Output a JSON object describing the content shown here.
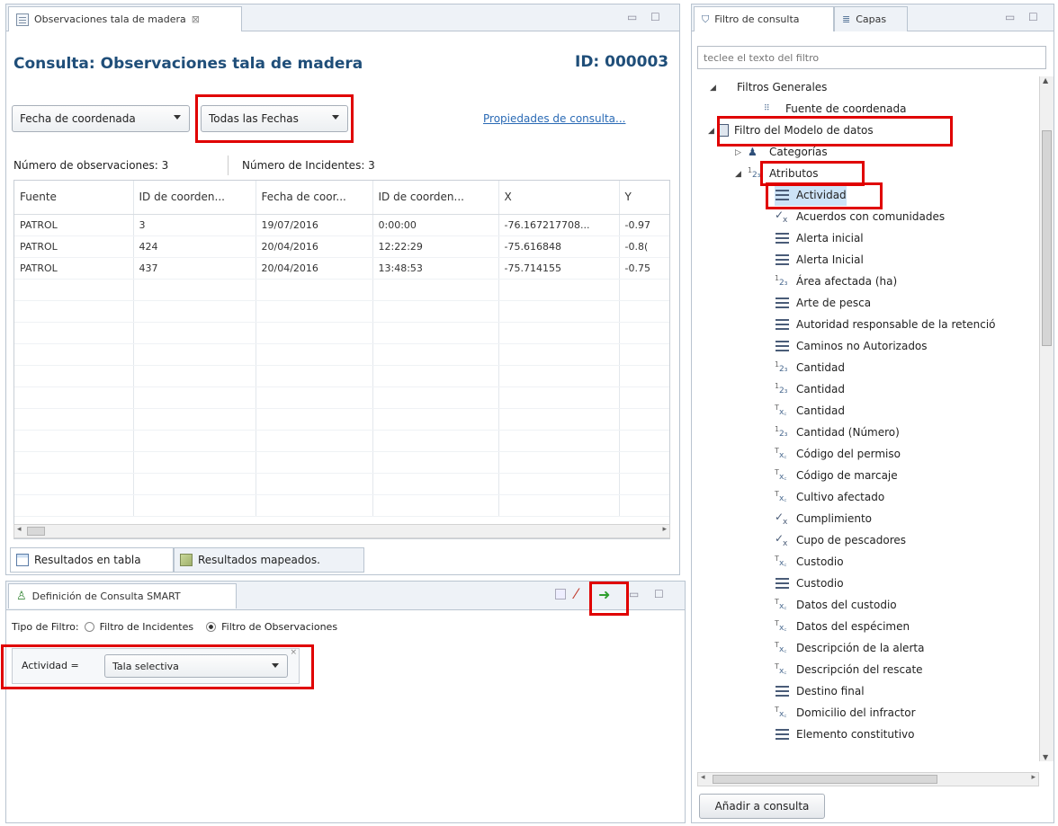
{
  "left_editor": {
    "tab_label": "Observaciones tala de madera",
    "tab_close": "⊠",
    "query_title": "Consulta:  Observaciones tala de madera",
    "query_id": "ID: 000003",
    "date_field_combo": "Fecha de coordenada",
    "date_range_combo": "Todas las Fechas",
    "properties_link": "Propiedades de consulta...",
    "observations_count": "Número de observaciones: 3",
    "incidents_count": "Número de Incidentes: 3",
    "table": {
      "columns": [
        "Fuente",
        "ID de coorden...",
        "Fecha de coor...",
        "ID de coorden...",
        "X",
        "Y"
      ],
      "rows": [
        [
          "PATROL",
          "3",
          "19/07/2016",
          "0:00:00",
          "-76.167217708...",
          "-0.97"
        ],
        [
          "PATROL",
          "424",
          "20/04/2016",
          "12:22:29",
          "-75.616848",
          "-0.8("
        ],
        [
          "PATROL",
          "437",
          "20/04/2016",
          "13:48:53",
          "-75.714155",
          "-0.75"
        ]
      ]
    },
    "bottom_tabs": [
      "Resultados en tabla",
      "Resultados mapeados."
    ]
  },
  "query_def": {
    "tab_label": "Definición de Consulta SMART",
    "filter_type_label": "Tipo de Filtro:",
    "radio_incidents": "Filtro de Incidentes",
    "radio_observations": "Filtro de Observaciones",
    "filter_field": "Actividad =",
    "filter_value": "Tala selectiva",
    "run_icon": "run-arrow-icon"
  },
  "right_panel": {
    "tabs": [
      "Filtro de consulta",
      "Capas"
    ],
    "filter_placeholder": "teclee el texto del filtro",
    "tree": [
      {
        "label": "Filtros Generales",
        "icon": "none"
      },
      {
        "label": "Fuente de coordenada",
        "icon": "coord"
      },
      {
        "label": "Filtro del Modelo de datos",
        "icon": "model"
      },
      {
        "label": "Categorías",
        "icon": "category"
      },
      {
        "label": "Atributos",
        "icon": "attr"
      },
      {
        "label": "Actividad",
        "icon": "lines"
      },
      {
        "label": "Acuerdos con comunidades",
        "icon": "check"
      },
      {
        "label": "Alerta inicial",
        "icon": "lines"
      },
      {
        "label": "Alerta Inicial",
        "icon": "lines"
      },
      {
        "label": "Área afectada (ha)",
        "icon": "num"
      },
      {
        "label": "Arte de pesca",
        "icon": "lines"
      },
      {
        "label": "Autoridad responsable de la retenció",
        "icon": "lines"
      },
      {
        "label": "Caminos no Autorizados",
        "icon": "lines"
      },
      {
        "label": "Cantidad",
        "icon": "num"
      },
      {
        "label": "Cantidad",
        "icon": "num"
      },
      {
        "label": "Cantidad",
        "icon": "txt"
      },
      {
        "label": "Cantidad (Número)",
        "icon": "num"
      },
      {
        "label": "Código del permiso",
        "icon": "txt"
      },
      {
        "label": "Código de marcaje",
        "icon": "txt"
      },
      {
        "label": "Cultivo afectado",
        "icon": "txt"
      },
      {
        "label": "Cumplimiento",
        "icon": "check"
      },
      {
        "label": "Cupo de pescadores",
        "icon": "check"
      },
      {
        "label": "Custodio",
        "icon": "txt"
      },
      {
        "label": "Custodio",
        "icon": "lines"
      },
      {
        "label": "Datos del custodio",
        "icon": "txt"
      },
      {
        "label": "Datos del espécimen",
        "icon": "txt"
      },
      {
        "label": "Descripción de la alerta",
        "icon": "txt"
      },
      {
        "label": "Descripción del rescate",
        "icon": "txt"
      },
      {
        "label": "Destino final",
        "icon": "lines"
      },
      {
        "label": "Domicilio del infractor",
        "icon": "txt"
      },
      {
        "label": "Elemento constitutivo",
        "icon": "lines"
      }
    ],
    "add_button": "Añadir a consulta"
  },
  "colors": {
    "highlight": "#e00000",
    "title": "#1f4e79",
    "link": "#2a6ab5"
  }
}
